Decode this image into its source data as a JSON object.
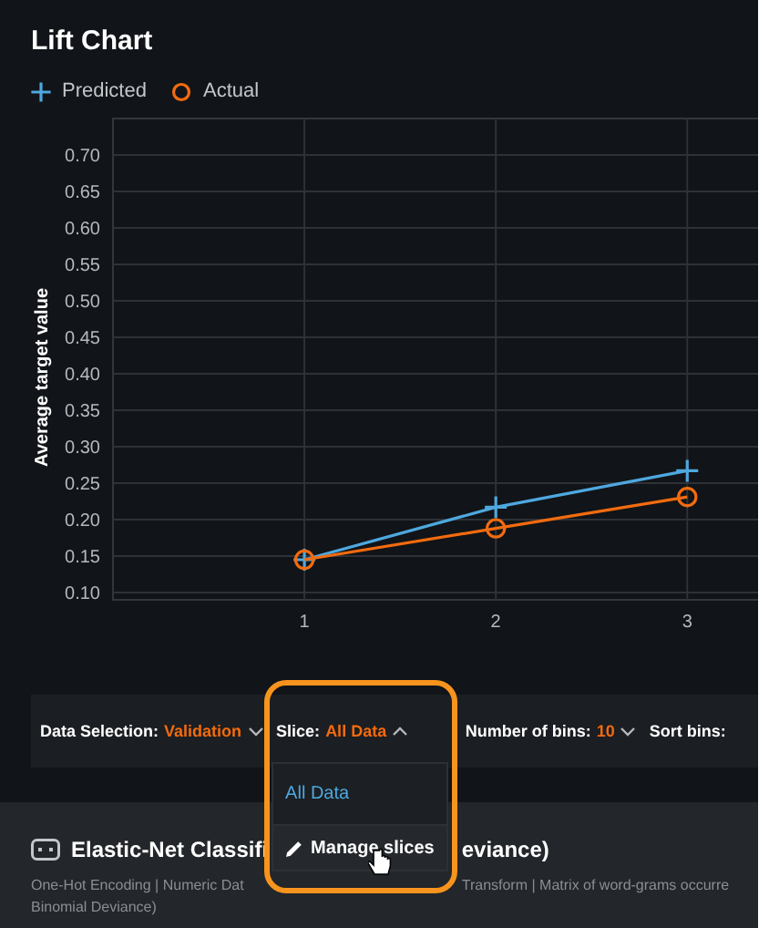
{
  "title": "Lift Chart",
  "chart_data": {
    "type": "line",
    "ylabel": "Average target value",
    "x": [
      1,
      2,
      3
    ],
    "xlim": [
      0,
      3.37
    ],
    "ylim": [
      0.09,
      0.75
    ],
    "grid": true,
    "xticks": [
      1,
      2,
      3
    ],
    "yticks": [
      {
        "value": 0.1,
        "label": "0.10"
      },
      {
        "value": 0.15,
        "label": "0.15"
      },
      {
        "value": 0.2,
        "label": "0.20"
      },
      {
        "value": 0.25,
        "label": "0.25"
      },
      {
        "value": 0.3,
        "label": "0.30"
      },
      {
        "value": 0.35,
        "label": "0.35"
      },
      {
        "value": 0.4,
        "label": "0.40"
      },
      {
        "value": 0.45,
        "label": "0.45"
      },
      {
        "value": 0.5,
        "label": "0.50"
      },
      {
        "value": 0.55,
        "label": "0.55"
      },
      {
        "value": 0.6,
        "label": "0.60"
      },
      {
        "value": 0.65,
        "label": "0.65"
      },
      {
        "value": 0.7,
        "label": "0.70"
      }
    ],
    "series": [
      {
        "name": "Predicted",
        "color": "#4ea8de",
        "marker": "plus",
        "values": [
          0.145,
          0.217,
          0.267
        ]
      },
      {
        "name": "Actual",
        "color": "#f26b0f",
        "marker": "circle",
        "values": [
          0.145,
          0.188,
          0.231
        ]
      }
    ]
  },
  "toolbar": [
    {
      "label": "Data Selection:",
      "value": "Validation",
      "expanded": false
    },
    {
      "label": "Slice:",
      "value": "All Data",
      "expanded": true
    },
    {
      "label": "Number of bins:",
      "value": "10",
      "expanded": false
    },
    {
      "label": "Sort bins:"
    }
  ],
  "dropdown": [
    {
      "kind": "option",
      "label": "All Data",
      "selected": true
    },
    {
      "kind": "action",
      "label": "Manage slices",
      "selected": false
    }
  ],
  "model": {
    "title_left": "Elastic-Net Classifi",
    "title_right": "eviance)",
    "description_left": "One-Hot Encoding | Numeric Dat",
    "description_right": "Transform | Matrix of word-grams occurre",
    "description_line2": "Binomial Deviance)"
  }
}
